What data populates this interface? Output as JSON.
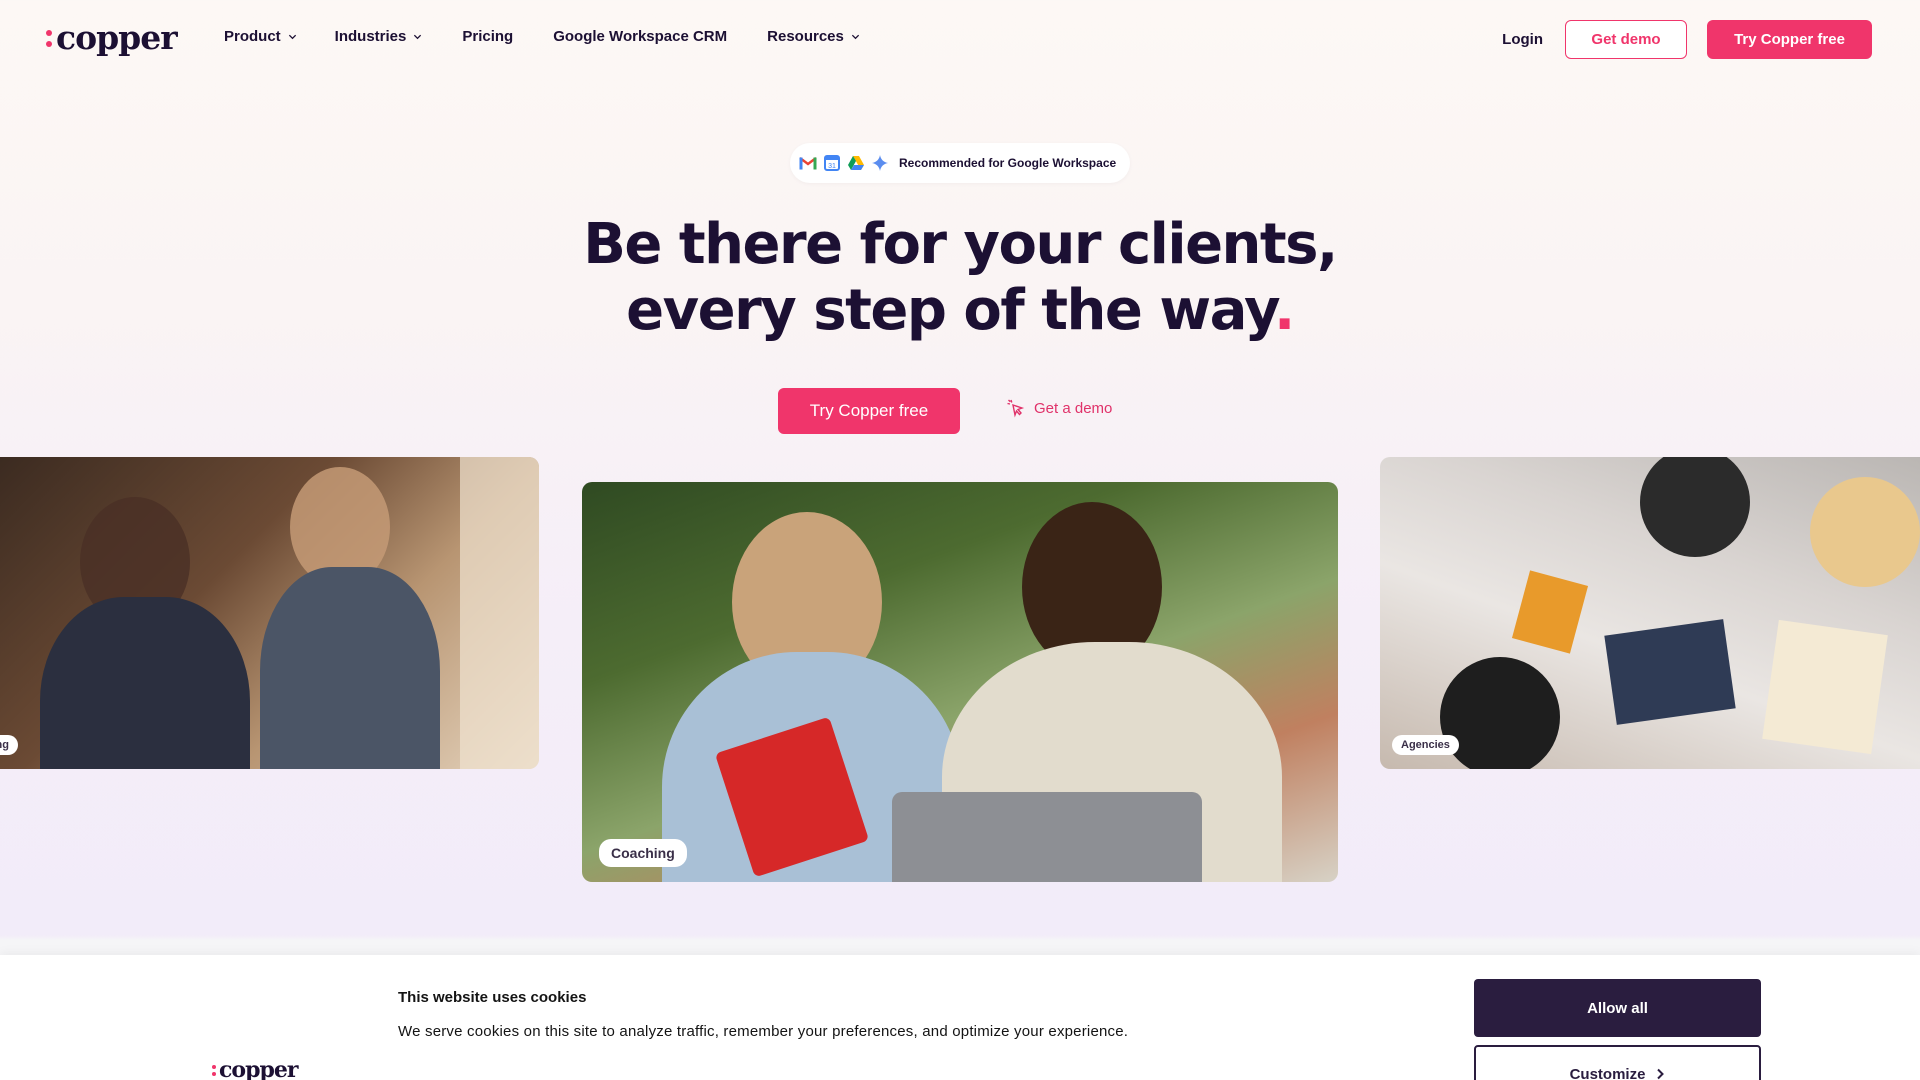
{
  "nav": {
    "logo": "copper",
    "links": [
      {
        "label": "Product",
        "has_dropdown": true
      },
      {
        "label": "Industries",
        "has_dropdown": true
      },
      {
        "label": "Pricing",
        "has_dropdown": false
      },
      {
        "label": "Google Workspace CRM",
        "has_dropdown": false
      },
      {
        "label": "Resources",
        "has_dropdown": true
      }
    ],
    "login": "Login",
    "get_demo": "Get demo",
    "try_free": "Try Copper free"
  },
  "hero": {
    "badge_icons": [
      "gmail-icon",
      "calendar-icon",
      "drive-icon",
      "gemini-icon"
    ],
    "badge_text": "Recommended for Google Workspace",
    "headline_line1": "Be there for your clients,",
    "headline_line2": "every step of the way",
    "headline_dot": ".",
    "cta_primary": "Try Copper free",
    "cta_secondary": "Get a demo"
  },
  "cards": {
    "left_tag": "ulting",
    "middle_tag": "Coaching",
    "right_tag": "Agencies"
  },
  "cookie_banner": {
    "logo": "copper",
    "title": "This website uses cookies",
    "description": "We serve cookies on this site to analyze traffic, remember your preferences, and optimize your experience.",
    "allow_all": "Allow all",
    "customize": "Customize"
  },
  "colors": {
    "brand_pink": "#f0356b",
    "ink": "#1c1033",
    "cookie_button": "#2a1d3f"
  }
}
